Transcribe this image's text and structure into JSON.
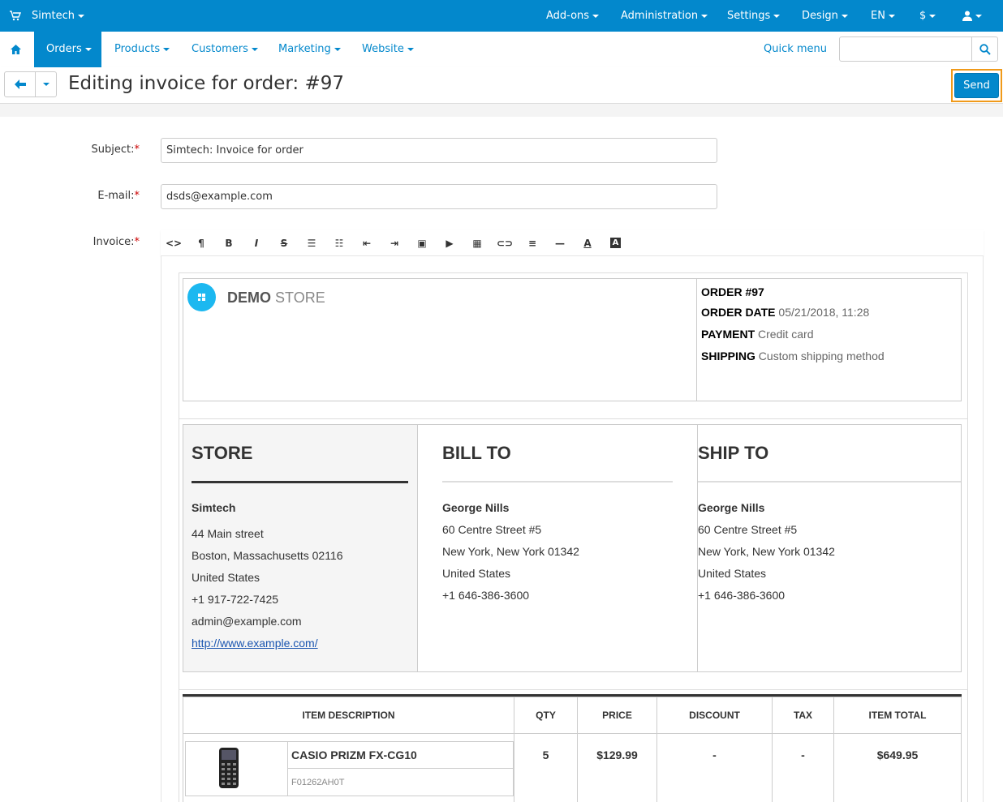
{
  "topbar": {
    "store": "Simtech",
    "menus": [
      "Add-ons",
      "Administration",
      "Settings",
      "Design",
      "EN",
      "$"
    ]
  },
  "nav": {
    "items": [
      "Orders",
      "Products",
      "Customers",
      "Marketing",
      "Website"
    ],
    "quick_menu": "Quick menu",
    "search_placeholder": ""
  },
  "header": {
    "title": "Editing invoice for order: #97",
    "send": "Send"
  },
  "form": {
    "subject_label": "Subject:",
    "subject_value": "Simtech: Invoice for order",
    "email_label": "E-mail:",
    "email_value": "dsds@example.com",
    "invoice_label": "Invoice:",
    "req": "*"
  },
  "toolbar": {
    "icons": [
      "code-icon",
      "paragraph-icon",
      "bold-icon",
      "italic-icon",
      "strikethrough-icon",
      "unordered-list-icon",
      "ordered-list-icon",
      "outdent-icon",
      "indent-icon",
      "image-icon",
      "video-icon",
      "table-icon",
      "link-icon",
      "align-icon",
      "horizontal-rule-icon",
      "font-color-icon",
      "background-color-icon"
    ],
    "glyphs": [
      "<>",
      "¶",
      "B",
      "I",
      "S",
      "☰",
      "☷",
      "⇤",
      "⇥",
      "▣",
      "▶",
      "▦",
      "⊂⊃",
      "≡",
      "—",
      "A",
      "A"
    ]
  },
  "invoice": {
    "logo_bold": "DEMO",
    "logo_light": "STORE",
    "order_label": "ORDER #97",
    "order_date_label": "ORDER DATE",
    "order_date": "05/21/2018, 11:28",
    "payment_label": "PAYMENT",
    "payment": "Credit card",
    "shipping_label": "SHIPPING",
    "shipping": "Custom shipping method",
    "store": {
      "heading": "STORE",
      "name": "Simtech",
      "street": "44 Main street",
      "city": "Boston, Massachusetts 02116",
      "country": "United States",
      "phone": "+1 917-722-7425",
      "email": "admin@example.com",
      "url": "http://www.example.com/"
    },
    "bill_to": {
      "heading": "BILL TO",
      "name": "George Nills",
      "street": "60 Centre Street #5",
      "city": "New York, New York 01342",
      "country": "United States",
      "phone": "+1 646-386-3600"
    },
    "ship_to": {
      "heading": "SHIP TO",
      "name": "George Nills",
      "street": "60 Centre Street #5",
      "city": "New York, New York 01342",
      "country": "United States",
      "phone": "+1 646-386-3600"
    },
    "table": {
      "columns": [
        "ITEM DESCRIPTION",
        "QTY",
        "PRICE",
        "DISCOUNT",
        "TAX",
        "ITEM TOTAL"
      ],
      "rows": [
        {
          "name": "CASIO PRIZM FX-CG10",
          "sku": "F01262AH0T",
          "qty": "5",
          "price": "$129.99",
          "discount": "-",
          "tax": "-",
          "total": "$649.95"
        }
      ]
    }
  }
}
